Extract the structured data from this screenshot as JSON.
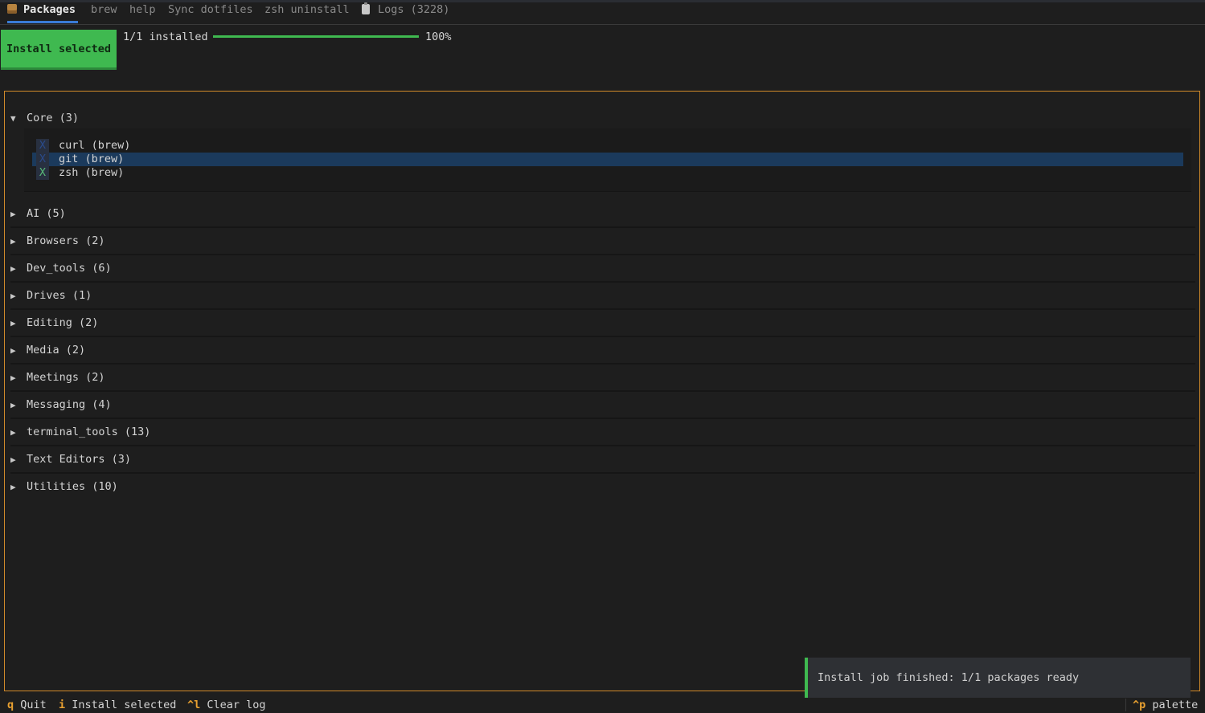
{
  "tabs": [
    {
      "label": "Packages",
      "icon": "package-icon"
    },
    {
      "label": "brew"
    },
    {
      "label": "help"
    },
    {
      "label": "Sync dotfiles"
    },
    {
      "label": "zsh uninstall"
    },
    {
      "label": "Logs (3228)",
      "icon": "clipboard-icon"
    }
  ],
  "toolbar": {
    "install_label": "Install selected",
    "progress_label": "1/1 installed",
    "progress_fraction": 1.0,
    "progress_percent": "100%"
  },
  "groups": {
    "expanded": {
      "label": "Core (3)",
      "packages": [
        {
          "name": "curl (brew)",
          "mark": "X"
        },
        {
          "name": "git (brew)",
          "mark": "X"
        },
        {
          "name": "zsh (brew)",
          "mark": "X"
        }
      ]
    },
    "collapsed": [
      "AI (5)",
      "Browsers (2)",
      "Dev_tools (6)",
      "Drives (1)",
      "Editing (2)",
      "Media (2)",
      "Meetings (2)",
      "Messaging (4)",
      "terminal_tools (13)",
      "Text Editors (3)",
      "Utilities (10)"
    ]
  },
  "toast": {
    "message": "Install job finished: 1/1 packages ready"
  },
  "footer": {
    "quit_key": "q",
    "quit_label": "Quit",
    "install_key": "i",
    "install_label": "Install selected",
    "clear_key": "^l",
    "clear_label": "Clear log",
    "palette_key": "^p",
    "palette_label": "palette"
  },
  "colors": {
    "accent": "#3fb950",
    "panel_border": "#d18a2a",
    "selection": "#1b3a5c",
    "key": "#e8a030",
    "tab_underline": "#3a7bd5"
  }
}
